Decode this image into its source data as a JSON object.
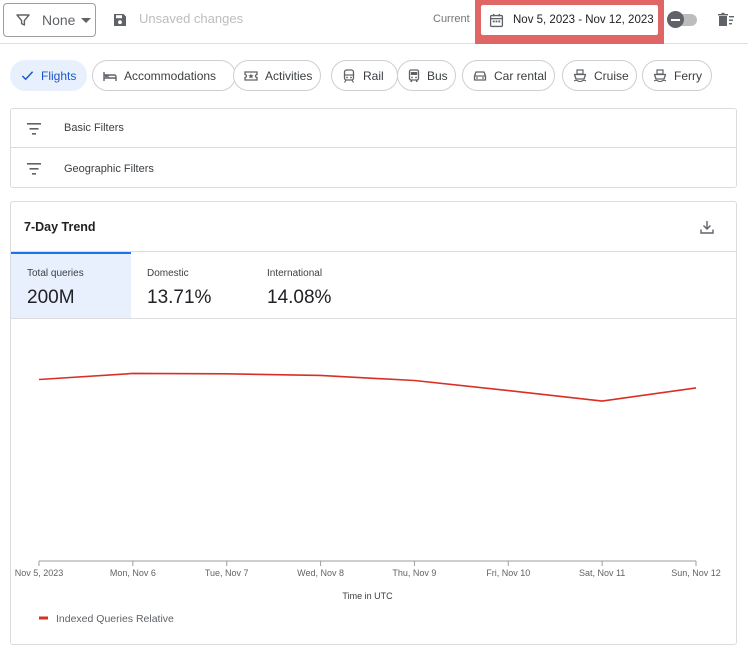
{
  "toolbar": {
    "filter_value": "None",
    "unsaved_label": "Unsaved changes",
    "current_label": "Current",
    "date_range": "Nov 5, 2023 - Nov 12, 2023",
    "highlight_color": "#e06666"
  },
  "chips": [
    {
      "label": "Flights",
      "icon": "check-icon",
      "active": true
    },
    {
      "label": "Accommodations",
      "icon": "bed-icon",
      "active": false
    },
    {
      "label": "Activities",
      "icon": "ticket-icon",
      "active": false
    },
    {
      "label": "Rail",
      "icon": "train-icon",
      "active": false
    },
    {
      "label": "Bus",
      "icon": "bus-icon",
      "active": false
    },
    {
      "label": "Car rental",
      "icon": "car-icon",
      "active": false
    },
    {
      "label": "Cruise",
      "icon": "ship-icon",
      "active": false
    },
    {
      "label": "Ferry",
      "icon": "ferry-icon",
      "active": false
    }
  ],
  "filters": [
    {
      "label": "Basic Filters"
    },
    {
      "label": "Geographic Filters"
    }
  ],
  "card": {
    "title": "7-Day Trend",
    "metrics": [
      {
        "label": "Total queries",
        "value": "200M",
        "selected": true
      },
      {
        "label": "Domestic",
        "value": "13.71%",
        "selected": false
      },
      {
        "label": "International",
        "value": "14.08%",
        "selected": false
      }
    ]
  },
  "chart_data": {
    "type": "line",
    "categories": [
      "Nov 5, 2023",
      "Mon, Nov 6",
      "Tue, Nov 7",
      "Wed, Nov 8",
      "Thu, Nov 9",
      "Fri, Nov 10",
      "Sat, Nov 11",
      "Sun, Nov 12"
    ],
    "series": [
      {
        "name": "Indexed Queries Relative",
        "values": [
          90.0,
          93.0,
          92.8,
          92.0,
          89.5,
          84.5,
          79.3,
          85.8
        ],
        "color": "#d93025"
      }
    ],
    "xlabel": "Time in UTC",
    "ylabel": "",
    "ylim": [
      0,
      120
    ],
    "grid": false,
    "legend": "bottom-left"
  }
}
